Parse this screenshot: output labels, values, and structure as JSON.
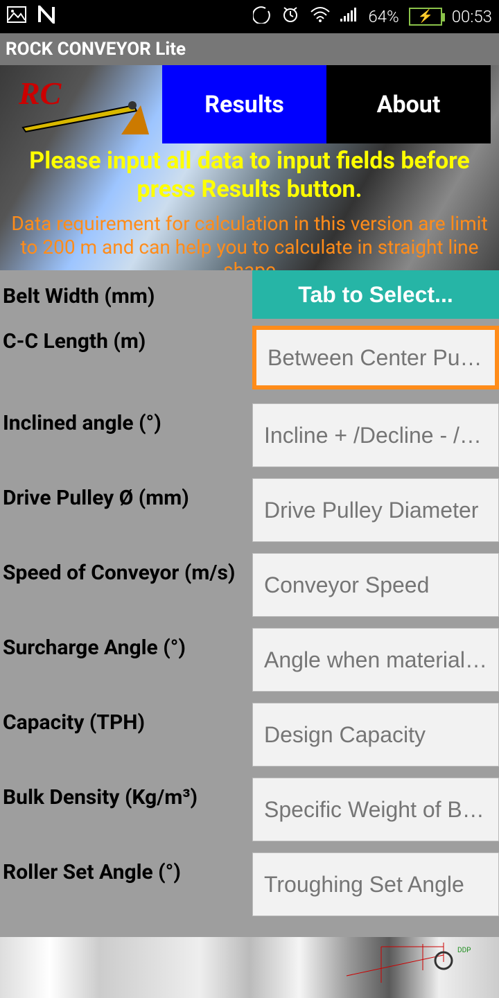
{
  "status": {
    "battery_pct": "64%",
    "time": "00:53"
  },
  "app": {
    "title": "ROCK CONVEYOR Lite"
  },
  "tabs": {
    "results": "Results",
    "about": "About"
  },
  "banner": {
    "line1": "Please input all data to input fields before press Results button.",
    "line2": "Data requirement for calculation in this version are limit to 200 m and can help you to calculate in straight line shape"
  },
  "fields": {
    "belt_width": {
      "label": "Belt Width (mm)",
      "select_text": "Tab to Select..."
    },
    "cc_length": {
      "label": "C-C Length (m)",
      "placeholder": "Between Center Pulleys"
    },
    "inclined_angle": {
      "label": "Inclined angle (°)",
      "placeholder": "Incline + /Decline - /Horiz"
    },
    "drive_pulley": {
      "label": "Drive Pulley Ø (mm)",
      "placeholder": "Drive Pulley Diameter"
    },
    "speed": {
      "label": "Speed of Conveyor (m/s)",
      "placeholder": "Conveyor Speed"
    },
    "surcharge": {
      "label": "Surcharge Angle (°)",
      "placeholder": "Angle when material mo"
    },
    "capacity": {
      "label": "Capacity (TPH)",
      "placeholder": "Design Capacity"
    },
    "bulk_density": {
      "label": "Bulk Density (Kg/m³)",
      "placeholder": "Specific Weight of Bulk M"
    },
    "roller_angle": {
      "label": "Roller Set Angle (°)",
      "placeholder": "Troughing Set Angle"
    }
  }
}
